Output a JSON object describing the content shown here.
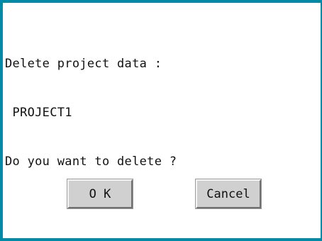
{
  "dialog": {
    "message_line1": "Delete project data :",
    "message_line2": " PROJECT1",
    "message_line3": "Do you want to delete ?",
    "ok_label": "O K",
    "cancel_label": "Cancel"
  },
  "colors": {
    "frame": "#008aa6",
    "background": "#ffffff",
    "button_face": "#d0d0d0"
  }
}
